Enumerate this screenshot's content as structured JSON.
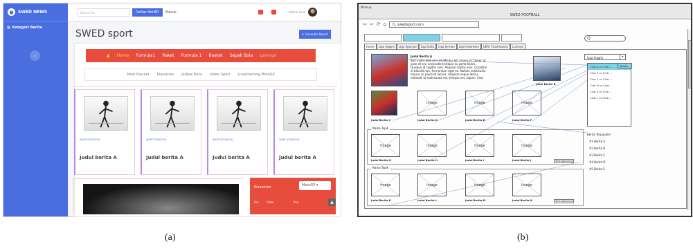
{
  "captions": {
    "a": "(a)",
    "b": "(b)"
  },
  "panel_a": {
    "brand": "SWED NEWS",
    "sidebar_item": "Kategori Berita",
    "search_placeholder": "Search for...",
    "btn_register": "Daftar AmMD",
    "btn_login": "Masuk",
    "user": "Valerie Luna",
    "page_title": "SWED sport",
    "report_btn": "Generate Report",
    "nav": [
      "Home",
      "Formula1",
      "Raket",
      "Formula 1",
      "Basket",
      "Sepak Bola",
      "Lainnya"
    ],
    "subnav": [
      "Most Popular",
      "Klasemen",
      "Jadwal Race",
      "Video Sport",
      "Livestreming MotoGP"
    ],
    "cards": [
      {
        "time": "WAKTU/TANGGAL",
        "headline": "Judul berita A"
      },
      {
        "time": "WAKTU/TANGGAL",
        "headline": "Judul berita A"
      },
      {
        "time": "WAKTU/TANGGAL",
        "headline": "Judul berita A"
      },
      {
        "time": "WAKTU/TANGGAL",
        "headline": "Judul berita A"
      }
    ],
    "klasemen": {
      "title": "Klasemen",
      "select": "MotoGP",
      "cols": [
        "Pos.",
        "Rider",
        "Poin"
      ]
    }
  },
  "panel_b": {
    "window_label": "Mockup",
    "window_title": "SWED FOOTBALL",
    "url": "swedsport.com",
    "search_glyph": "Q",
    "menu": [
      "Home",
      "Liga Inggris",
      "Liga Spanyol",
      "Liga Italia",
      "Liga Jerman",
      "Liga Indonesia",
      "UEFA Chaempions",
      "Lainnya"
    ],
    "main_headline": "Judul Berita A",
    "main_text": [
      "Sed mollis felis orci, id efficitur elit ornare id. Donec at",
      "justo et orci venenatis tristique eu porta libero.",
      "Quisque id sagittis sem. Aliquam mattis eros. Curabitur",
      "et blandit non, fermentum eget ex. Nullam sollicitudin",
      "mauris ac placerat lacinia. Aliquam neque lectus,",
      "molestie ut malesuada vel, tempus nec sapien. Cras"
    ],
    "image_label": "Image",
    "labels_row1": [
      "Judul Berita B",
      "Judul Berita C",
      "Judul Berita D",
      "Judul Berita E",
      "Judul Berita F"
    ],
    "section1": "Nama Topik",
    "section2": "Nama Topik",
    "labels_row2": [
      "Judul Berita G",
      "Judul Berita H",
      "Judul Berita I",
      "Judul Berita J"
    ],
    "labels_row3": [
      "Judul Berita K",
      "Judul Berita L",
      "Judul Berita M",
      "Judul Berita N"
    ],
    "more": "Selengkapnya",
    "dropdown": "Liga Inggris",
    "list": [
      "Club A vs Club ...",
      "Club E vs Club ...",
      "Club C vs Club ...",
      "Club D vs Club ...",
      "Club S vs Club ...",
      "Club F vs Club ..."
    ],
    "list_link": "Waktu",
    "popular_title": "Berita Terpopuler",
    "popular": [
      "#1 Berita A",
      "#2 Berita B",
      "#3 Berita C",
      "#4 Berita D",
      "#5 Berita E"
    ]
  }
}
